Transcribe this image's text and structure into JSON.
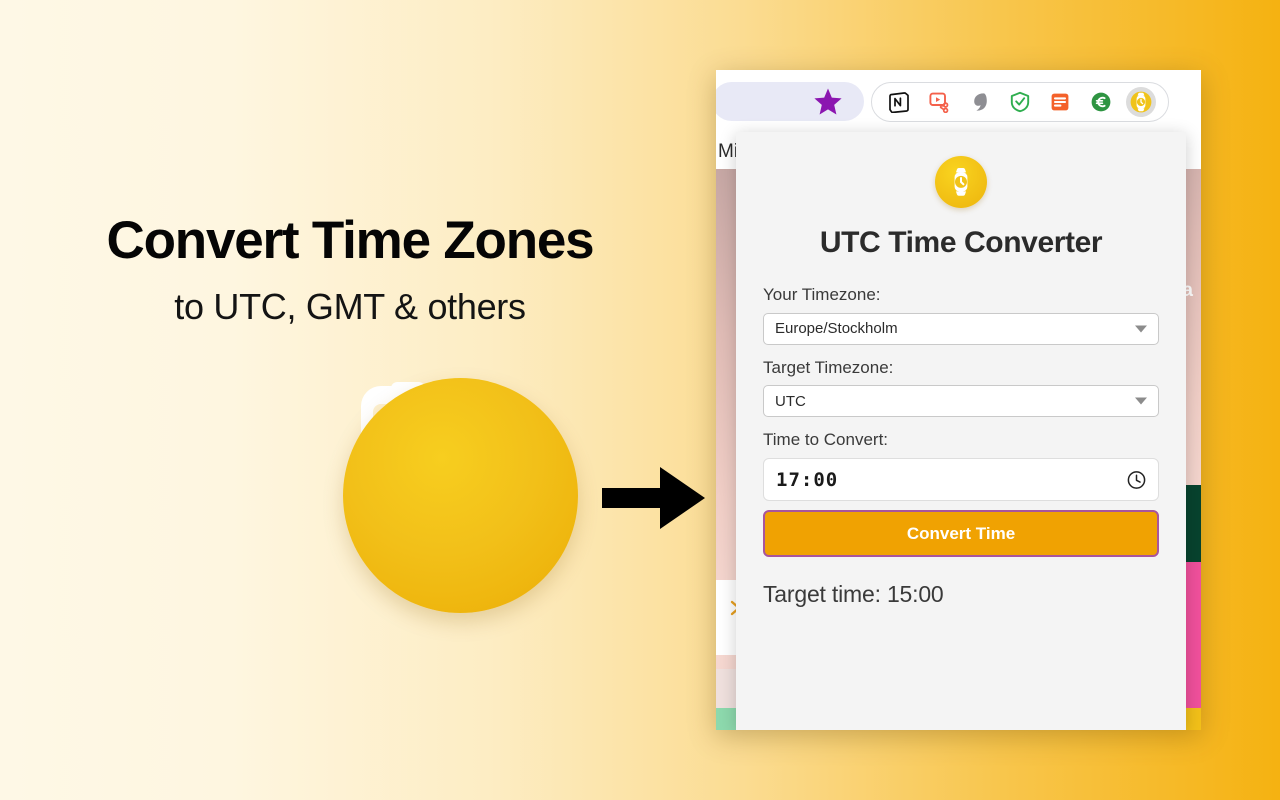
{
  "promo": {
    "headline": "Convert Time Zones",
    "subheadline": "to UTC, GMT & others",
    "watch_icon": "smartwatch-icon",
    "arrow_icon": "right-arrow-icon",
    "accent_color": "#F2C019",
    "background_gradient_start": "#FEF8E6",
    "background_gradient_end": "#F5B211"
  },
  "browser": {
    "bookmark_star_icon": "star-icon",
    "extensions": [
      {
        "name": "notion-extension-icon",
        "label": "N"
      },
      {
        "name": "screen-recorder-extension-icon",
        "label": ""
      },
      {
        "name": "vpn-extension-icon",
        "label": ""
      },
      {
        "name": "shield-check-extension-icon",
        "label": ""
      },
      {
        "name": "document-extension-icon",
        "label": ""
      },
      {
        "name": "currency-euro-extension-icon",
        "label": ""
      },
      {
        "name": "utc-time-converter-extension-icon",
        "label": "",
        "active": true
      }
    ],
    "page_behind": {
      "text_left": "Min",
      "text_right": "Ka",
      "strip_colors": [
        "#8DD9AD",
        "#16A05A",
        "#E87722",
        "#F29B2A",
        "#D94532",
        "#E8557E",
        "#C8338E",
        "#F2C019"
      ]
    }
  },
  "popup": {
    "logo_icon": "smartwatch-icon",
    "title": "UTC Time Converter",
    "source_timezone": {
      "label": "Your Timezone:",
      "value": "Europe/Stockholm",
      "caret_icon": "chevron-down-icon"
    },
    "target_timezone": {
      "label": "Target Timezone:",
      "value": "UTC",
      "caret_icon": "chevron-down-icon"
    },
    "time_input": {
      "label": "Time to Convert:",
      "value": "17:00",
      "placeholder": "--:--",
      "clock_icon": "clock-icon"
    },
    "convert_button": {
      "label": "Convert Time",
      "fill_color": "#F0A202",
      "border_color": "#A8559C"
    },
    "result_text": "Target time: 15:00"
  }
}
